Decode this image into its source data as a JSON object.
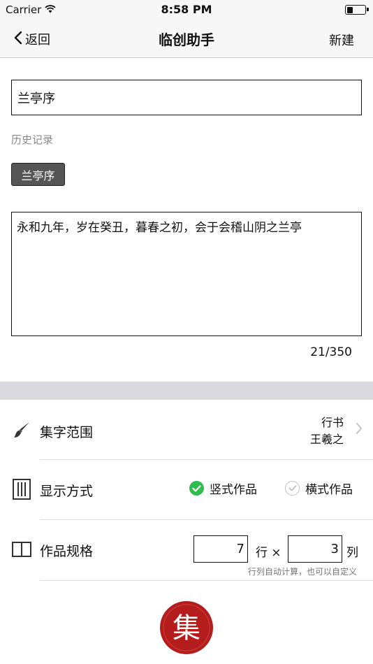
{
  "status_bar": {
    "carrier": "Carrier",
    "time": "8:58 PM",
    "battery_level": 0.35
  },
  "nav": {
    "back_label": "返回",
    "title": "临创助手",
    "right_label": "新建"
  },
  "title_field": {
    "value": "兰亭序"
  },
  "history": {
    "label": "历史记录",
    "items": [
      "兰亭序"
    ]
  },
  "content": {
    "text": "永和九年，岁在癸丑，暮春之初，会于会稽山阴之兰亭",
    "count": "21/350"
  },
  "settings": {
    "range": {
      "label": "集字范围",
      "icon": "brush-icon",
      "style": "行书",
      "author": "王羲之"
    },
    "display": {
      "label": "显示方式",
      "icon": "vertical-layout-icon",
      "options": [
        {
          "label": "竖式作品",
          "selected": true
        },
        {
          "label": "横式作品",
          "selected": false
        }
      ]
    },
    "spec": {
      "label": "作品规格",
      "icon": "columns-icon",
      "rows_value": "7",
      "rows_unit": "行 ×",
      "cols_value": "3",
      "cols_unit": "列",
      "hint": "行列自动计算，也可以自定义"
    }
  },
  "seal": {
    "icon": "seal-logo-icon",
    "char": "集"
  },
  "colors": {
    "accent_green": "#2dbd4e",
    "seal_red": "#b51d1d",
    "chip_bg": "#555555",
    "divider": "#d9d9de"
  }
}
